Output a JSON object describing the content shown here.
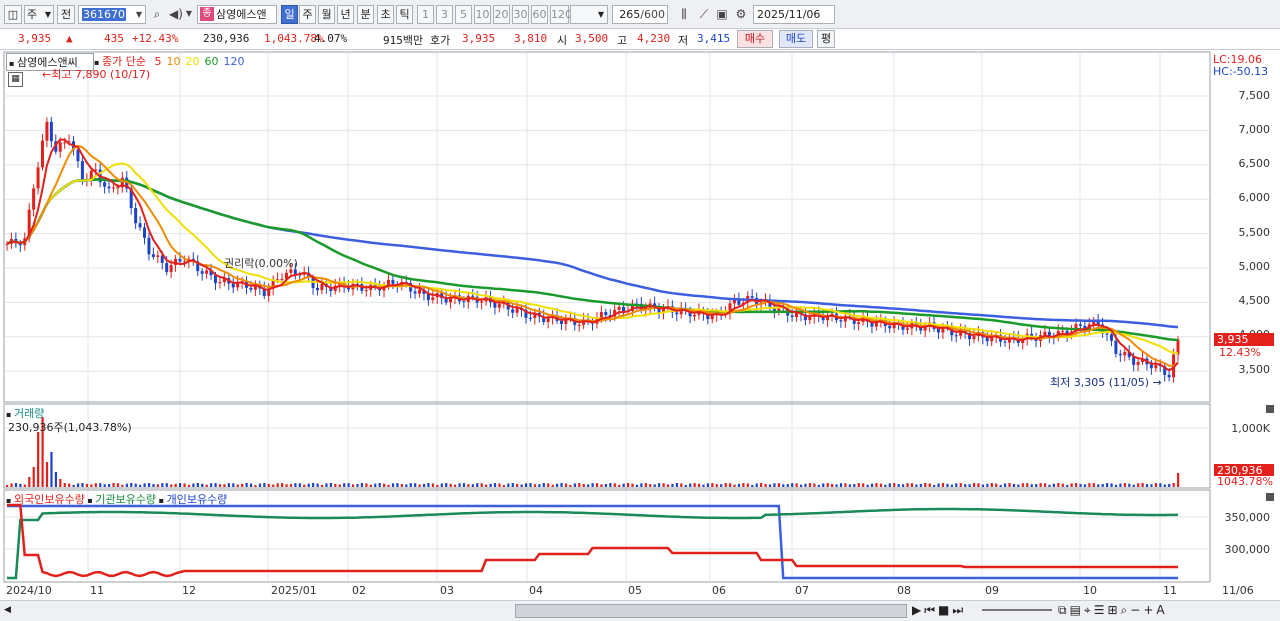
{
  "toolbar": {
    "market": "주",
    "period_prev": "전",
    "code": "361670",
    "name_badge": "종",
    "name": "삼영에스앤",
    "periods": [
      "일",
      "주",
      "월",
      "년",
      "분",
      "초",
      "틱"
    ],
    "intervals": [
      "1",
      "3",
      "5",
      "10",
      "20",
      "30",
      "60",
      "120"
    ],
    "count": "265",
    "count_total": "/600",
    "date": "2025/11/06"
  },
  "quote": {
    "price": "3,935",
    "arrow": "▲",
    "change": "435",
    "change_pct": "+12.43%",
    "volume": "230,936",
    "volume_pct": "1,043.78%",
    "turnover": "4.07%",
    "amount": "915백만",
    "bid_label": "호가",
    "bid1": "3,935",
    "bid2": "3,810",
    "open_label": "시",
    "open": "3,500",
    "high_label": "고",
    "high": "4,230",
    "low_label": "저",
    "low": "3,415",
    "buy": "매수",
    "sell": "매도",
    "eval": "평"
  },
  "main_panel": {
    "stock_name": "삼영에스앤씨",
    "ma_title": "종가 단순",
    "ma_periods": [
      "5",
      "10",
      "20",
      "60",
      "120"
    ],
    "ma_colors": {
      "5": "#e2211c",
      "10": "#f08c00",
      "20": "#f0e000",
      "60": "#1a9a2a",
      "120": "#3b5fe0"
    },
    "high_note": "최고 7,890 (10/17)",
    "low_note": "최저 3,305 (11/05)",
    "ex_rights_note": "권리락(0.00%)",
    "lc": "LC:19.06",
    "hc": "HC:-50.13",
    "current_price": "3,935",
    "current_pct": "12.43%",
    "y_labels": [
      "7,500",
      "7,000",
      "6,500",
      "6,000",
      "5,500",
      "5,000",
      "4,500",
      "4,000",
      "3,500"
    ]
  },
  "volume_panel": {
    "title": "거래량",
    "value": "230,936주(1,043.78%)",
    "y_label": "1,000K",
    "badge_value": "230,936",
    "badge_pct": "1043.78%"
  },
  "holdings_panel": {
    "legend": [
      "외국인보유수량",
      "기관보유수량",
      "개인보유수량"
    ],
    "y_labels": [
      "350,000",
      "300,000"
    ]
  },
  "x_axis": [
    "2024/10",
    "11",
    "12",
    "2025/01",
    "02",
    "03",
    "04",
    "05",
    "06",
    "07",
    "08",
    "09",
    "10",
    "11"
  ],
  "x_axis_right": "11/06",
  "colors": {
    "up": "#e2211c",
    "down": "#1d44c8",
    "accent": "#3f6fd3"
  }
}
